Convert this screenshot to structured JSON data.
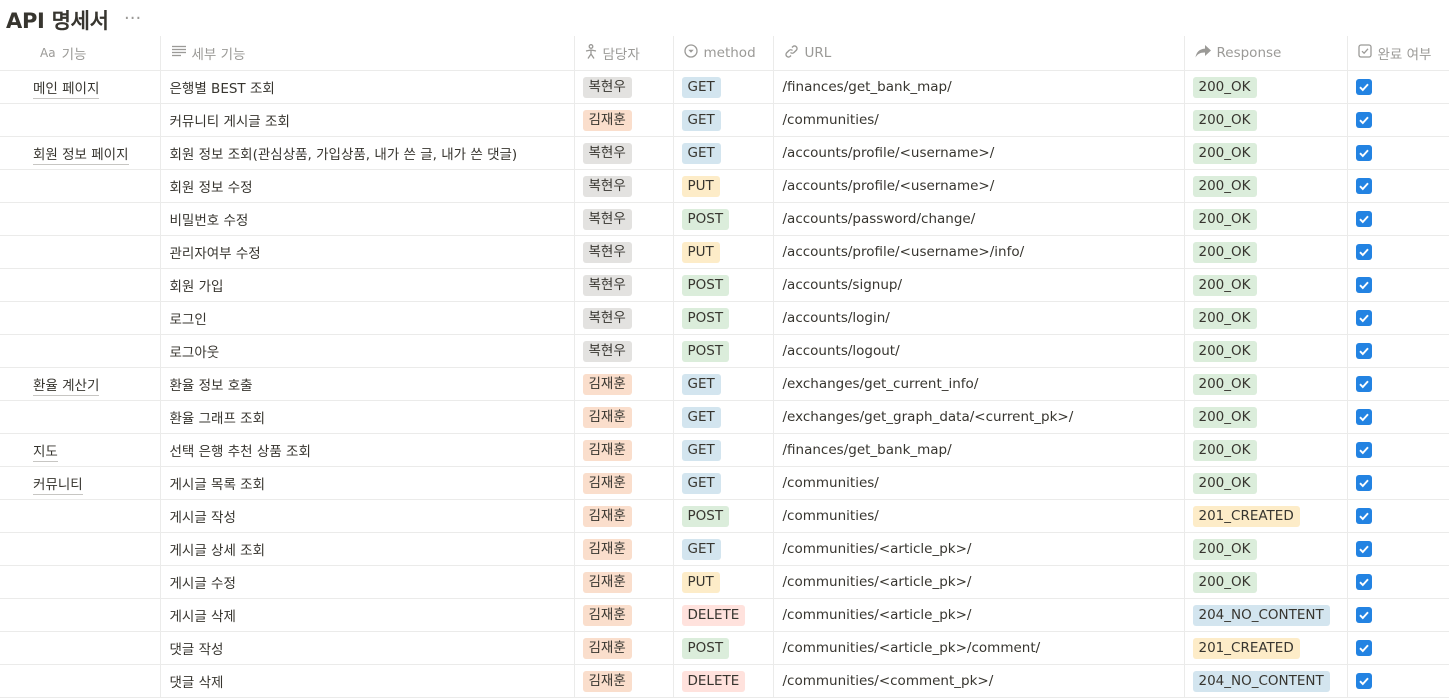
{
  "page": {
    "title": "API 명세서",
    "more_label": "···"
  },
  "columns": {
    "feature": "기능",
    "detail": "세부 기능",
    "owner": "담당자",
    "method": "method",
    "url": "URL",
    "response": "Response",
    "done": "완료 여부"
  },
  "column_icons": {
    "feature": "title-icon",
    "detail": "text-lines-icon",
    "owner": "person-icon",
    "method": "select-icon",
    "url": "link-icon",
    "response": "arrow-icon",
    "done": "checkbox-icon"
  },
  "tag_colors": {
    "owner": {
      "복현우": "#e3e2e0",
      "김재훈": "#fadecc"
    },
    "method": {
      "GET": "#d3e5ef",
      "POST": "#dbeddb",
      "PUT": "#fdecc8",
      "DELETE": "#ffe2dd"
    },
    "response": {
      "200_OK": "#dbeddb",
      "201_CREATED": "#fdecc8",
      "204_NO_CONTENT": "#d3e5ef"
    }
  },
  "rows": [
    {
      "feature": "메인 페이지",
      "detail": "은행별 BEST 조회",
      "owner": "복현우",
      "method": "GET",
      "url": "/finances/get_bank_map/",
      "response": "200_OK",
      "done": true
    },
    {
      "feature": "",
      "detail": "커뮤니티 게시글 조회",
      "owner": "김재훈",
      "method": "GET",
      "url": "/communities/",
      "response": "200_OK",
      "done": true
    },
    {
      "feature": "회원 정보 페이지",
      "detail": "회원 정보 조회(관심상품, 가입상품, 내가 쓴 글, 내가 쓴 댓글)",
      "owner": "복현우",
      "method": "GET",
      "url": "/accounts/profile/<username>/",
      "response": "200_OK",
      "done": true
    },
    {
      "feature": "",
      "detail": "회원 정보 수정",
      "owner": "복현우",
      "method": "PUT",
      "url": "/accounts/profile/<username>/",
      "response": "200_OK",
      "done": true
    },
    {
      "feature": "",
      "detail": "비밀번호 수정",
      "owner": "복현우",
      "method": "POST",
      "url": "/accounts/password/change/",
      "response": "200_OK",
      "done": true
    },
    {
      "feature": "",
      "detail": "관리자여부 수정",
      "owner": "복현우",
      "method": "PUT",
      "url": "/accounts/profile/<username>/info/",
      "response": "200_OK",
      "done": true
    },
    {
      "feature": "",
      "detail": "회원 가입",
      "owner": "복현우",
      "method": "POST",
      "url": "/accounts/signup/",
      "response": "200_OK",
      "done": true
    },
    {
      "feature": "",
      "detail": "로그인",
      "owner": "복현우",
      "method": "POST",
      "url": "/accounts/login/",
      "response": "200_OK",
      "done": true
    },
    {
      "feature": "",
      "detail": "로그아웃",
      "owner": "복현우",
      "method": "POST",
      "url": "/accounts/logout/",
      "response": "200_OK",
      "done": true
    },
    {
      "feature": "환율 계산기",
      "detail": "환율 정보 호출",
      "owner": "김재훈",
      "method": "GET",
      "url": "/exchanges/get_current_info/",
      "response": "200_OK",
      "done": true
    },
    {
      "feature": "",
      "detail": "환율 그래프 조회",
      "owner": "김재훈",
      "method": "GET",
      "url": "/exchanges/get_graph_data/<current_pk>/",
      "response": "200_OK",
      "done": true
    },
    {
      "feature": "지도",
      "detail": "선택 은행 추천 상품 조회",
      "owner": "김재훈",
      "method": "GET",
      "url": "/finances/get_bank_map/",
      "response": "200_OK",
      "done": true
    },
    {
      "feature": "커뮤니티",
      "detail": "게시글 목록 조회",
      "owner": "김재훈",
      "method": "GET",
      "url": "/communities/",
      "response": "200_OK",
      "done": true
    },
    {
      "feature": "",
      "detail": "게시글 작성",
      "owner": "김재훈",
      "method": "POST",
      "url": "/communities/",
      "response": "201_CREATED",
      "done": true
    },
    {
      "feature": "",
      "detail": "게시글 상세 조회",
      "owner": "김재훈",
      "method": "GET",
      "url": "/communities/<article_pk>/",
      "response": "200_OK",
      "done": true
    },
    {
      "feature": "",
      "detail": "게시글 수정",
      "owner": "김재훈",
      "method": "PUT",
      "url": "/communities/<article_pk>/",
      "response": "200_OK",
      "done": true
    },
    {
      "feature": "",
      "detail": "게시글 삭제",
      "owner": "김재훈",
      "method": "DELETE",
      "url": "/communities/<article_pk>/",
      "response": "204_NO_CONTENT",
      "done": true
    },
    {
      "feature": "",
      "detail": "댓글 작성",
      "owner": "김재훈",
      "method": "POST",
      "url": "/communities/<article_pk>/comment/",
      "response": "201_CREATED",
      "done": true
    },
    {
      "feature": "",
      "detail": "댓글 삭제",
      "owner": "김재훈",
      "method": "DELETE",
      "url": "/communities/<comment_pk>/",
      "response": "204_NO_CONTENT",
      "done": true
    }
  ]
}
